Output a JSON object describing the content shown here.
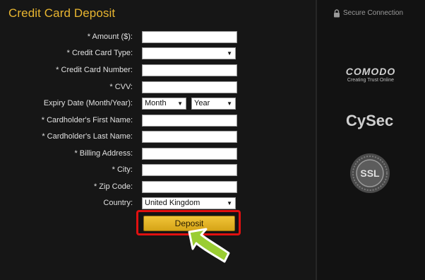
{
  "title": "Credit Card Deposit",
  "secure_connection": "Secure Connection",
  "form": {
    "amount_label": "* Amount ($):",
    "amount_value": "",
    "card_type_label": "* Credit Card Type:",
    "card_type_value": "",
    "card_number_label": "* Credit Card Number:",
    "card_number_value": "",
    "cvv_label": "* CVV:",
    "cvv_value": "",
    "expiry_label": "Expiry Date (Month/Year):",
    "expiry_month_value": "Month",
    "expiry_year_value": "Year",
    "first_name_label": "* Cardholder's First Name:",
    "first_name_value": "",
    "last_name_label": "* Cardholder's Last Name:",
    "last_name_value": "",
    "billing_address_label": "* Billing Address:",
    "billing_address_value": "",
    "city_label": "* City:",
    "city_value": "",
    "zip_label": "* Zip Code:",
    "zip_value": "",
    "country_label": "Country:",
    "country_value": "United Kingdom",
    "deposit_button": "Deposit"
  },
  "badges": {
    "comodo_name": "COMODO",
    "comodo_tagline": "Creating Trust Online",
    "cysec": "CySec",
    "ssl": "SSL"
  },
  "colors": {
    "title": "#e8b530",
    "deposit_button": "#e2b020",
    "highlight_frame": "#e01010",
    "arrow": "#9acd32"
  }
}
